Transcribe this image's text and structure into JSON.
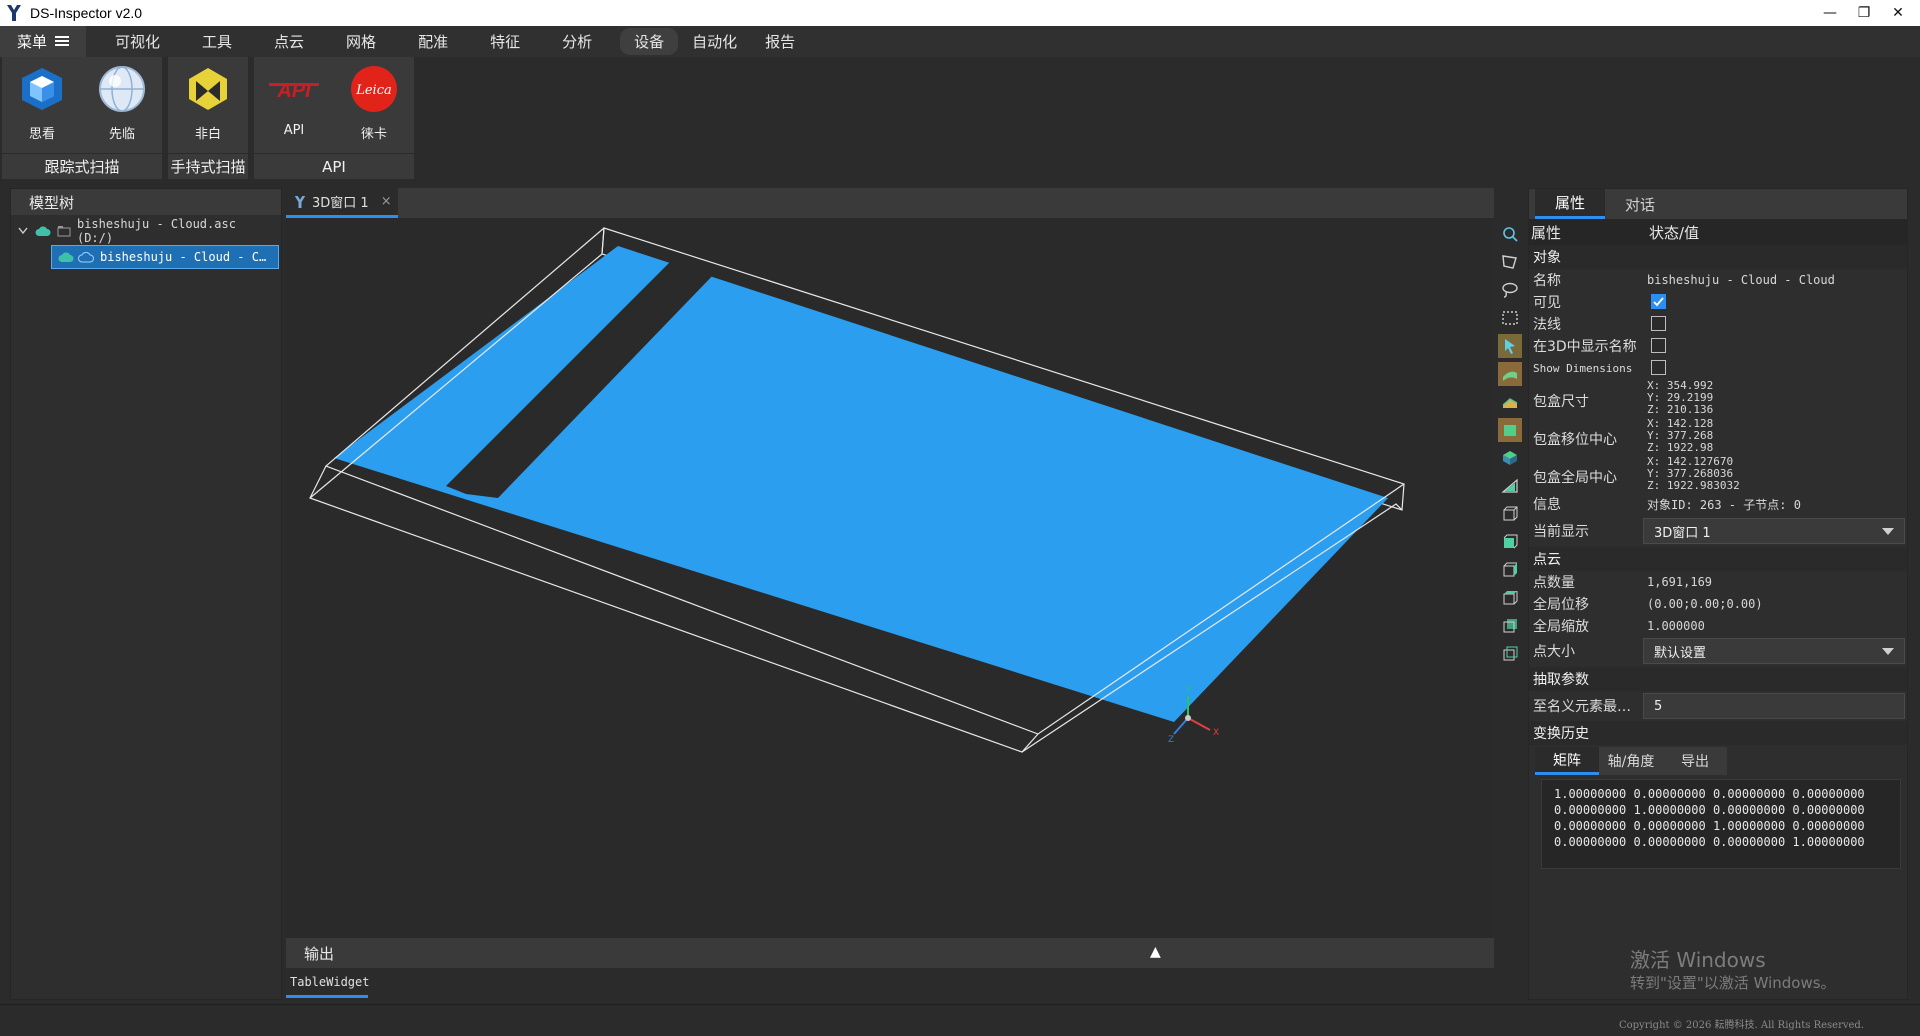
{
  "titlebar": {
    "title": "DS-Inspector v2.0",
    "minimize": "—",
    "maximize": "❐",
    "close": "✕"
  },
  "menubar": {
    "main_label": "菜单",
    "items": [
      {
        "label": "可视化"
      },
      {
        "label": "工具"
      },
      {
        "label": "点云"
      },
      {
        "label": "网格"
      },
      {
        "label": "配准"
      },
      {
        "label": "特征"
      },
      {
        "label": "分析"
      },
      {
        "label": "设备"
      },
      {
        "label": "自动化"
      },
      {
        "label": "报告"
      }
    ],
    "active": "设备"
  },
  "ribbon": {
    "groups": [
      {
        "name": "跟踪式扫描",
        "buttons": [
          {
            "label": "思看",
            "icon": "cube-scanner-icon"
          },
          {
            "label": "先临",
            "icon": "sphere-globe-icon"
          }
        ]
      },
      {
        "name": "手持式扫描",
        "buttons": [
          {
            "label": "非白",
            "icon": "yellow-hexagon-icon"
          }
        ]
      },
      {
        "name": "API",
        "buttons": [
          {
            "label": "API",
            "icon": "api-logo-icon"
          },
          {
            "label": "徕卡",
            "icon": "leica-logo-icon"
          }
        ]
      }
    ],
    "logo_text": {
      "api": "API",
      "leica": "Leica"
    }
  },
  "model_tree": {
    "title": "模型树",
    "items": [
      {
        "label": "bisheshuju - Cloud.asc (D:/)",
        "selected": false
      },
      {
        "label": "bisheshuju - Cloud - C…",
        "selected": true
      }
    ]
  },
  "viewer": {
    "tab_label": "3D窗口 1",
    "tab_close": "×",
    "cloud_color": "#2b9ef0",
    "axes": {
      "x": "X",
      "y": "Y",
      "z": "Z"
    }
  },
  "output": {
    "title": "输出",
    "toggle": "▲",
    "tab_label": "TableWidget"
  },
  "properties": {
    "tabs": [
      {
        "label": "属性",
        "active": true
      },
      {
        "label": "对话",
        "active": false
      }
    ],
    "header": {
      "col1": "属性",
      "col2": "状态/值"
    },
    "sections": {
      "object": "对象",
      "cloud": "点云",
      "sampling": "抽取参数",
      "transform": "变换历史"
    },
    "rows": {
      "name": {
        "k": "名称",
        "v": "bisheshuju - Cloud - Cloud"
      },
      "visible": {
        "k": "可见",
        "checked": true
      },
      "normals": {
        "k": "法线",
        "checked": false
      },
      "show_name": {
        "k": "在3D中显示名称",
        "checked": false
      },
      "show_dims": {
        "k": "Show Dimensions",
        "checked": false
      },
      "bbox_size": {
        "k": "包盒尺寸",
        "x": "X: 354.992",
        "y": "Y: 29.2199",
        "z": "Z: 210.136"
      },
      "bbox_center": {
        "k": "包盒移位中心",
        "x": "X: 142.128",
        "y": "Y: 377.268",
        "z": "Z: 1922.98"
      },
      "bbox_global": {
        "k": "包盒全局中心",
        "x": "X: 142.127670",
        "y": "Y: 377.268036",
        "z": "Z: 1922.983032"
      },
      "info": {
        "k": "信息",
        "v": "对象ID: 263 - 子节点: 0"
      },
      "current_display": {
        "k": "当前显示",
        "v": "3D窗口 1"
      },
      "point_count": {
        "k": "点数量",
        "v": "1,691,169"
      },
      "global_shift": {
        "k": "全局位移",
        "v": "(0.00;0.00;0.00)"
      },
      "global_scale": {
        "k": "全局缩放",
        "v": "1.000000"
      },
      "point_size": {
        "k": "点大小",
        "v": "默认设置"
      },
      "min_elem": {
        "k": "至名义元素最…",
        "v": "5"
      }
    },
    "transform_tabs": [
      {
        "label": "矩阵",
        "active": true
      },
      {
        "label": "轴/角度",
        "active": false
      },
      {
        "label": "导出",
        "active": false
      }
    ],
    "matrix": [
      "1.00000000 0.00000000 0.00000000 0.00000000",
      "0.00000000 1.00000000 0.00000000 0.00000000",
      "0.00000000 0.00000000 1.00000000 0.00000000",
      "0.00000000 0.00000000 0.00000000 1.00000000"
    ]
  },
  "watermark": {
    "line1": "激活 Windows",
    "line2": "转到\"设置\"以激活 Windows。"
  },
  "footer": {
    "copyright": "Copyright © 2026 耘腾科技. All Rights Reserved."
  }
}
